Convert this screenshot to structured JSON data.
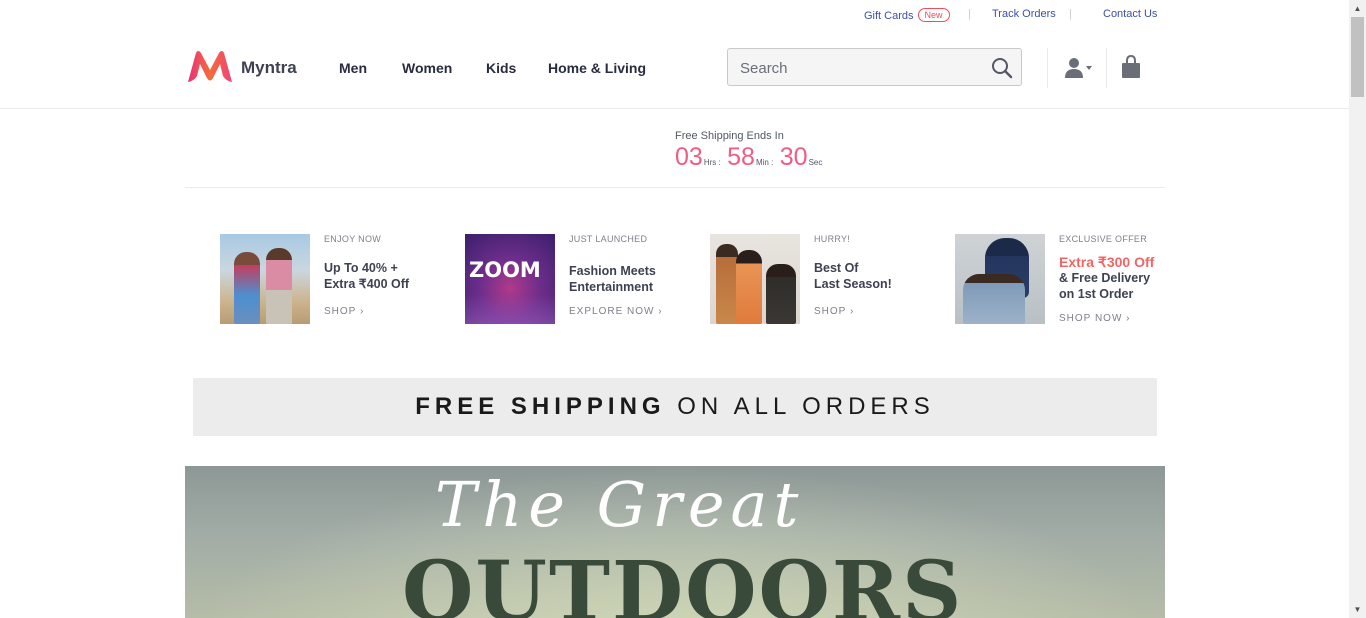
{
  "utility": {
    "gift_cards": "Gift Cards",
    "new_badge": "New",
    "track_orders": "Track Orders",
    "contact_us": "Contact Us",
    "separator": "|"
  },
  "header": {
    "brand": "Myntra",
    "nav": [
      "Men",
      "Women",
      "Kids",
      "Home & Living"
    ],
    "search_placeholder": "Search"
  },
  "countdown": {
    "label": "Free Shipping Ends In",
    "hours": "03",
    "hours_unit": "Hrs :",
    "minutes": "58",
    "minutes_unit": "Min :",
    "seconds": "30",
    "seconds_unit": "Sec"
  },
  "promos": [
    {
      "tag": "ENJOY NOW",
      "line1": "Up To 40% +",
      "line2": "Extra ₹400 Off",
      "cta": "SHOP"
    },
    {
      "tag": "JUST LAUNCHED",
      "line1": "Fashion Meets",
      "line2": "Entertainment",
      "cta": "EXPLORE NOW",
      "img_text": "ZOOM"
    },
    {
      "tag": "HURRY!",
      "line1": "Best Of",
      "line2": "Last Season!",
      "cta": "SHOP"
    },
    {
      "tag": "EXCLUSIVE OFFER",
      "line1": "Extra ₹300 Off",
      "line2": "& Free Delivery",
      "line3": "on 1st Order",
      "cta": "SHOP NOW"
    }
  ],
  "banner": {
    "bold": "FREE SHIPPING",
    "light": "ON ALL ORDERS"
  },
  "hero": {
    "script": "The Great",
    "big": "OUTDOORS"
  },
  "colors": {
    "accent_pink": "#f05d82",
    "link_blue": "#3c4fa5",
    "offer_red": "#f16565"
  }
}
